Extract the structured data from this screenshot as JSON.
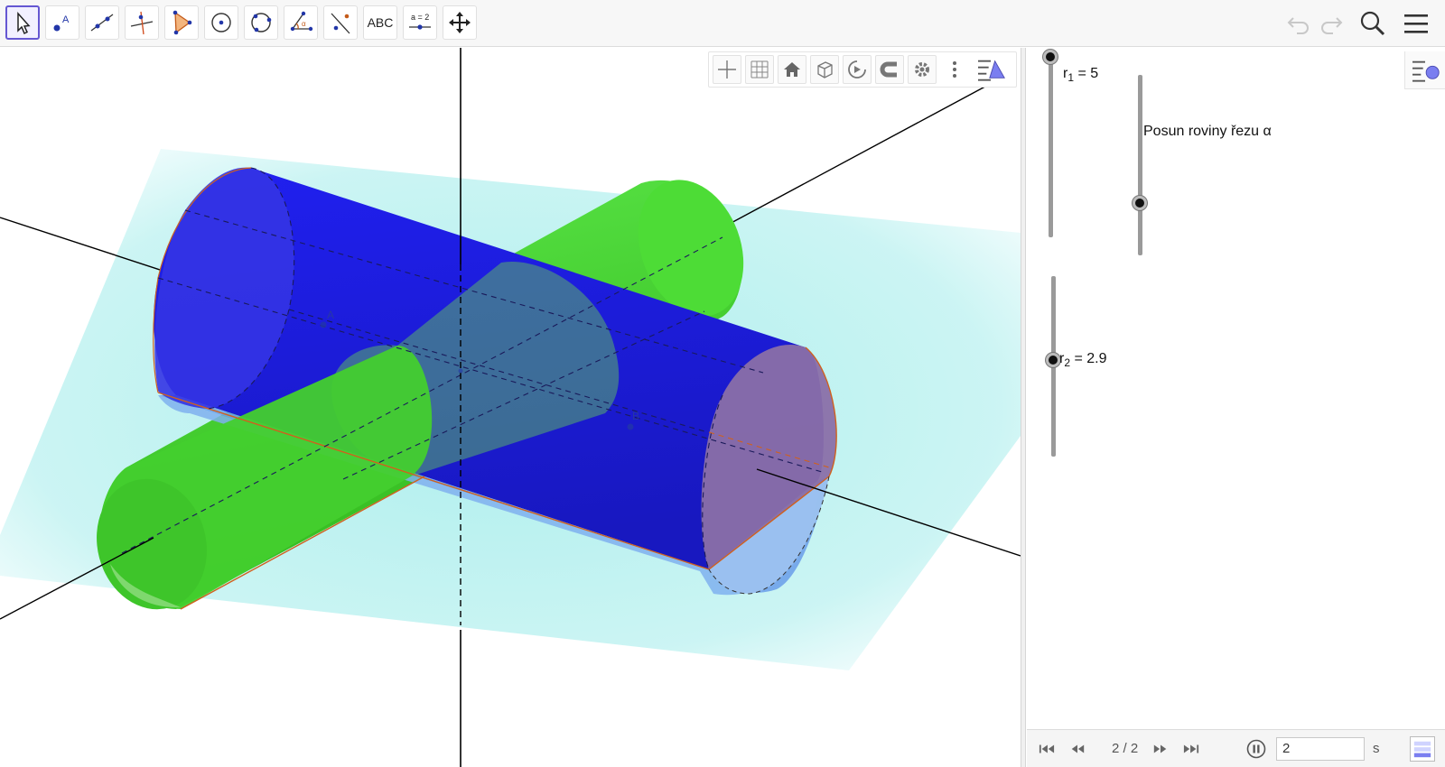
{
  "toolbar": {
    "tools": [
      {
        "name": "move-tool",
        "icon": "cursor-arrow-icon",
        "selected": true
      },
      {
        "name": "point-tool",
        "icon": "point-a-icon",
        "label": "A"
      },
      {
        "name": "line-tool",
        "icon": "line-through-points-icon"
      },
      {
        "name": "perpendicular-line-tool",
        "icon": "perpendicular-line-icon"
      },
      {
        "name": "polygon-tool",
        "icon": "triangle-polygon-icon"
      },
      {
        "name": "circle-tool",
        "icon": "circle-center-icon"
      },
      {
        "name": "circle-three-points-tool",
        "icon": "circle-three-points-icon"
      },
      {
        "name": "angle-tool",
        "icon": "angle-alpha-icon",
        "label": "α"
      },
      {
        "name": "reflect-tool",
        "icon": "reflect-line-icon"
      },
      {
        "name": "text-tool",
        "icon": "text-icon",
        "label": "ABC"
      },
      {
        "name": "slider-tool",
        "icon": "slider-icon",
        "label": "a = 2"
      },
      {
        "name": "move-graphics-tool",
        "icon": "move-view-icon"
      }
    ],
    "undo_icon": "undo-icon",
    "redo_icon": "redo-icon",
    "search_icon": "search-icon",
    "menu_icon": "hamburger-menu-icon"
  },
  "graphics_bar": {
    "buttons": [
      "axes-icon",
      "grid-icon",
      "home-icon",
      "cube-icon",
      "rotate-view-icon",
      "magnet-snapping-icon",
      "settings-gear-icon",
      "more-vertical-icon",
      "style-bar-toggle-icon"
    ]
  },
  "scene": {
    "point_labels": [
      "A",
      "B"
    ],
    "colors": {
      "plane": "#bff0ef",
      "cylinder_large": "#1c1cd6",
      "cylinder_small": "#3fcf2a",
      "intersection": "#d0611e",
      "axis": "#000000"
    }
  },
  "sliders": [
    {
      "id": "r1",
      "symbol": "r",
      "sub": "1",
      "text": " = 5",
      "value": 5
    },
    {
      "id": "alpha",
      "text": "Posun roviny řezu α"
    },
    {
      "id": "r2",
      "symbol": "r",
      "sub": "2",
      "text": " = 2.9",
      "value": 2.9
    }
  ],
  "animation_bar": {
    "page": "2 / 2",
    "speed_value": "2",
    "unit": "s",
    "buttons": [
      "skip-first-icon",
      "rewind-icon",
      "fast-forward-icon",
      "skip-last-icon",
      "pause-icon"
    ],
    "keyboard_icon": "algebra-input-icon"
  }
}
